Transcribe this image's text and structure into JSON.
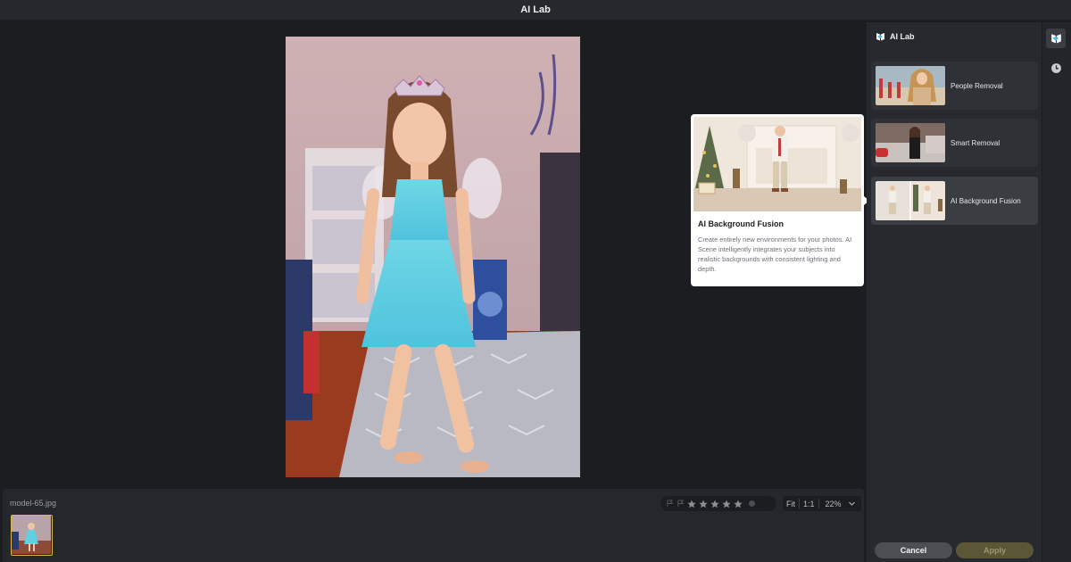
{
  "titlebar": {
    "title": "AI Lab"
  },
  "filmstrip": {
    "filename": "model-65.jpg"
  },
  "rating": {
    "stars": 0,
    "max": 5
  },
  "zoom": {
    "fit": "Fit",
    "one_to_one": "1:1",
    "level": "22%"
  },
  "panel": {
    "title": "AI Lab",
    "tools": [
      {
        "label": "People Removal"
      },
      {
        "label": "Smart Removal"
      },
      {
        "label": "AI Background Fusion"
      }
    ],
    "cancel": "Cancel",
    "apply": "Apply"
  },
  "popover": {
    "title": "AI Background Fusion",
    "description": "Create entirely new environments for your photos. AI Scene intelligently integrates your subjects into realistic backgrounds with consistent lighting and depth."
  },
  "colors": {
    "accent": "#d9b84a",
    "apply_disabled": "#5b5635",
    "panel_bg": "#26292d"
  },
  "icons": [
    "ai-lab-logo-icon",
    "history-clock-icon",
    "flag-icon",
    "star-icon",
    "chevron-down-icon"
  ]
}
